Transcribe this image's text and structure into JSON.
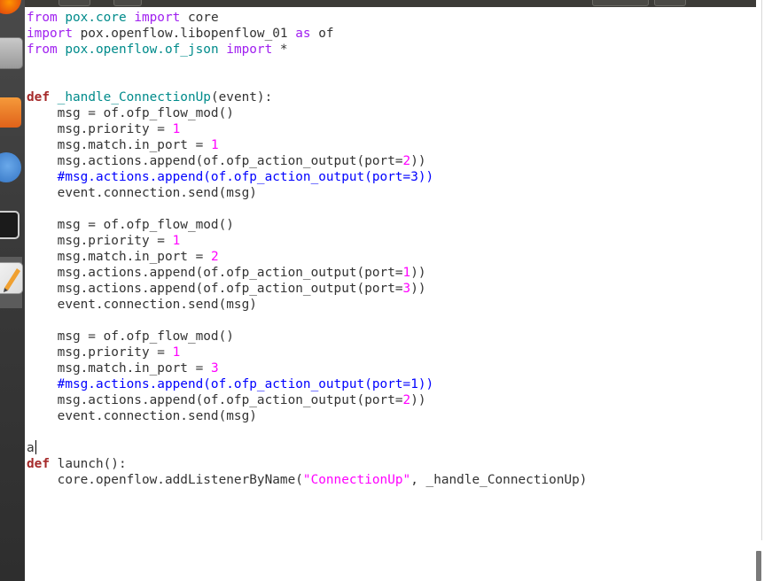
{
  "launcher": {
    "items": [
      {
        "name": "firefox-icon"
      },
      {
        "name": "files-icon"
      },
      {
        "name": "software-center-icon"
      },
      {
        "name": "help-icon"
      },
      {
        "name": "terminal-icon"
      },
      {
        "name": "text-editor-icon"
      }
    ]
  },
  "editor": {
    "lines": [
      [
        [
          "kw",
          "from"
        ],
        [
          "t",
          " "
        ],
        [
          "mod",
          "pox.core"
        ],
        [
          "t",
          " "
        ],
        [
          "kw",
          "import"
        ],
        [
          "t",
          " core"
        ]
      ],
      [
        [
          "kw",
          "import"
        ],
        [
          "t",
          " pox.openflow.libopenflow_01 "
        ],
        [
          "kw",
          "as"
        ],
        [
          "t",
          " of"
        ]
      ],
      [
        [
          "kw",
          "from"
        ],
        [
          "t",
          " "
        ],
        [
          "mod",
          "pox.openflow.of_json"
        ],
        [
          "t",
          " "
        ],
        [
          "kw",
          "import"
        ],
        [
          "t",
          " *"
        ]
      ],
      [],
      [],
      [
        [
          "kwb",
          "def"
        ],
        [
          "t",
          " "
        ],
        [
          "fn",
          "_handle_ConnectionUp"
        ],
        [
          "t",
          "(event):"
        ]
      ],
      [
        [
          "t",
          "    msg = of.ofp_flow_mod()"
        ]
      ],
      [
        [
          "t",
          "    msg.priority = "
        ],
        [
          "num",
          "1"
        ]
      ],
      [
        [
          "t",
          "    msg.match.in_port = "
        ],
        [
          "num",
          "1"
        ]
      ],
      [
        [
          "t",
          "    msg.actions.append(of.ofp_action_output(port="
        ],
        [
          "num",
          "2"
        ],
        [
          "t",
          "))"
        ]
      ],
      [
        [
          "cmt",
          "    #msg.actions.append(of.ofp_action_output(port=3))"
        ]
      ],
      [
        [
          "t",
          "    event.connection.send(msg)"
        ]
      ],
      [],
      [
        [
          "t",
          "    msg = of.ofp_flow_mod()"
        ]
      ],
      [
        [
          "t",
          "    msg.priority = "
        ],
        [
          "num",
          "1"
        ]
      ],
      [
        [
          "t",
          "    msg.match.in_port = "
        ],
        [
          "num",
          "2"
        ]
      ],
      [
        [
          "t",
          "    msg.actions.append(of.ofp_action_output(port="
        ],
        [
          "num",
          "1"
        ],
        [
          "t",
          "))"
        ]
      ],
      [
        [
          "t",
          "    msg.actions.append(of.ofp_action_output(port="
        ],
        [
          "num",
          "3"
        ],
        [
          "t",
          "))"
        ]
      ],
      [
        [
          "t",
          "    event.connection.send(msg)"
        ]
      ],
      [],
      [
        [
          "t",
          "    msg = of.ofp_flow_mod()"
        ]
      ],
      [
        [
          "t",
          "    msg.priority = "
        ],
        [
          "num",
          "1"
        ]
      ],
      [
        [
          "t",
          "    msg.match.in_port = "
        ],
        [
          "num",
          "3"
        ]
      ],
      [
        [
          "cmt",
          "    #msg.actions.append(of.ofp_action_output(port=1))"
        ]
      ],
      [
        [
          "t",
          "    msg.actions.append(of.ofp_action_output(port="
        ],
        [
          "num",
          "2"
        ],
        [
          "t",
          "))"
        ]
      ],
      [
        [
          "t",
          "    event.connection.send(msg)"
        ]
      ],
      [],
      [
        [
          "t",
          "a"
        ],
        [
          "cursor",
          ""
        ]
      ],
      [
        [
          "kwb",
          "def"
        ],
        [
          "t",
          " launch():"
        ]
      ],
      [
        [
          "t",
          "    core.openflow.addListenerByName("
        ],
        [
          "str",
          "\"ConnectionUp\""
        ],
        [
          "t",
          ", _handle_ConnectionUp)"
        ]
      ]
    ]
  }
}
